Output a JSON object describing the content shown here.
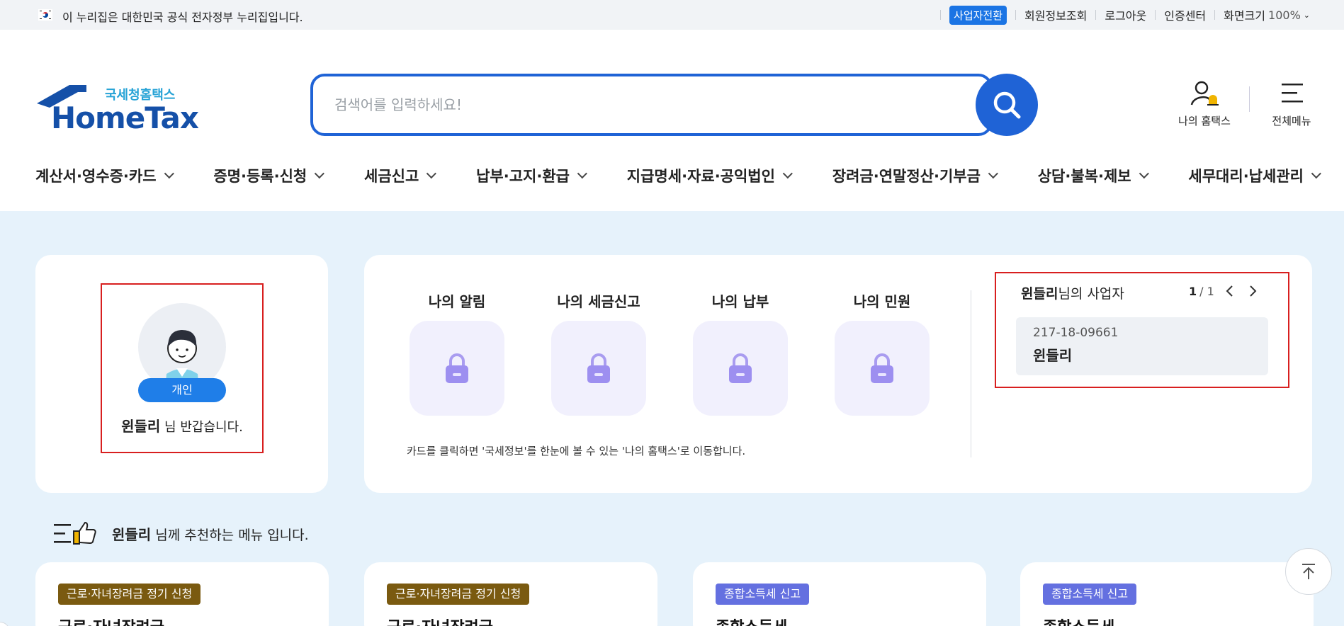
{
  "govbar": {
    "text": "이 누리집은 대한민국 공식 전자정부 누리집입니다.",
    "links": {
      "business_switch": "사업자전환",
      "member_info": "회원정보조회",
      "logout": "로그아웃",
      "cert_center": "인증센터",
      "screen_size_label": "화면크기",
      "screen_size_value": "100%"
    }
  },
  "logo": {
    "sub": "국세청홈택스",
    "main": "HomeTax"
  },
  "search": {
    "placeholder": "검색어를 입력하세요!"
  },
  "header": {
    "my_hometax": "나의 홈택스",
    "all_menu": "전체메뉴"
  },
  "nav": [
    "계산서·영수증·카드",
    "증명·등록·신청",
    "세금신고",
    "납부·고지·환급",
    "지급명세·자료·공익법인",
    "장려금·연말정산·기부금",
    "상담·불복·제보",
    "세무대리·납세관리"
  ],
  "profile": {
    "badge": "개인",
    "name": "윈들리",
    "greeting": " 님 반갑습니다."
  },
  "quick": [
    {
      "label": "나의 알림"
    },
    {
      "label": "나의 세금신고"
    },
    {
      "label": "나의 납부"
    },
    {
      "label": "나의 민원"
    }
  ],
  "card_note": "카드를 클릭하면 '국세정보'를 한눈에 볼 수 있는 '나의 홈택스'로 이동합니다.",
  "business": {
    "owner_name": "윈들리",
    "title_suffix": "님의 사업자",
    "page_current": "1",
    "page_total": "/ 1",
    "item": {
      "number": "217-18-09661",
      "name": "윈들리"
    }
  },
  "recommend": {
    "name": "윈들리",
    "text": " 님께 추천하는 메뉴 입니다."
  },
  "services": [
    {
      "tag": "근로·자녀장려금 정기 신청",
      "title": "근로·자녀장려금",
      "tag_color": "#7a5a10"
    },
    {
      "tag": "근로·자녀장려금 정기 신청",
      "title": "근로·자녀장려금",
      "tag_color": "#7a5a10"
    },
    {
      "tag": "종합소득세 신고",
      "title": "종합소득세",
      "tag_color": "#6470e0"
    },
    {
      "tag": "종합소득세 신고",
      "title": "종합소득세",
      "tag_color": "#6470e0"
    }
  ],
  "colors": {
    "accent": "#1f63d6",
    "bg_content": "#e6f2fb",
    "highlight_border": "#d81f1f"
  }
}
